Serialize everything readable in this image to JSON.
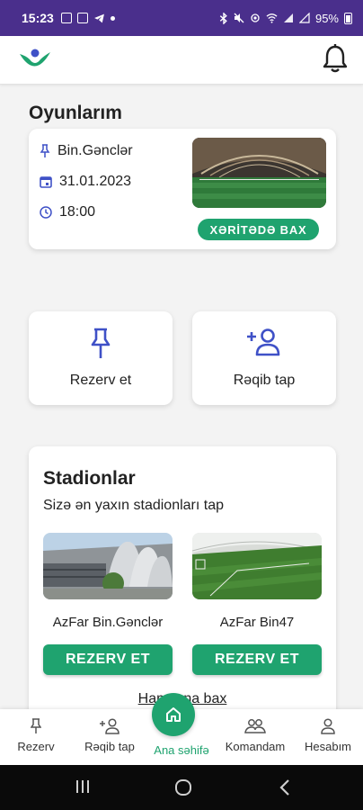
{
  "status_bar": {
    "time": "15:23",
    "battery": "95%"
  },
  "colors": {
    "accent": "#1fa36f",
    "status_bar": "#4a2f8c",
    "icon_blue": "#3f51c7"
  },
  "my_games": {
    "title": "Oyunlarım",
    "location": "Bin.Gənclər",
    "date": "31.01.2023",
    "time": "18:00",
    "map_button": "XƏRİTƏDƏ BAX"
  },
  "actions": [
    {
      "label": "Rezerv et",
      "icon": "pin-icon"
    },
    {
      "label": "Rəqib tap",
      "icon": "add-user-icon"
    }
  ],
  "stadiums": {
    "title": "Stadionlar",
    "subtitle": "Sizə ən yaxın stadionları tap",
    "items": [
      {
        "name": "AzFar Bin.Gənclər",
        "button": "REZERV ET"
      },
      {
        "name": "AzFar Bin47",
        "button": "REZERV ET"
      }
    ],
    "see_all": "Hamısına bax"
  },
  "bottom_nav": {
    "items": [
      {
        "label": "Rezerv",
        "icon": "pin-icon"
      },
      {
        "label": "Rəqib tap",
        "icon": "add-user-icon"
      },
      {
        "label": "Ana səhifə",
        "icon": "home-icon"
      },
      {
        "label": "Komandam",
        "icon": "team-icon"
      },
      {
        "label": "Hesabım",
        "icon": "user-icon"
      }
    ]
  }
}
